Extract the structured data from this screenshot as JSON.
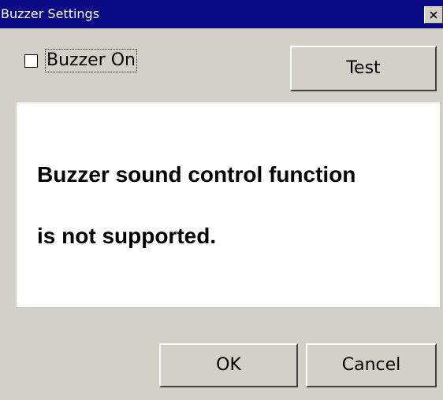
{
  "window": {
    "title": "Buzzer Settings",
    "close_icon": "close-icon"
  },
  "buzzer": {
    "checkbox_label": "Buzzer On",
    "checked": false,
    "test_label": "Test"
  },
  "message": {
    "line1": "Buzzer sound control function",
    "line2": "is not supported."
  },
  "footer": {
    "ok_label": "OK",
    "cancel_label": "Cancel"
  },
  "colors": {
    "titlebar": "#0b0b86",
    "dialog_bg": "#d4d0c8",
    "panel_bg": "#ffffff"
  }
}
